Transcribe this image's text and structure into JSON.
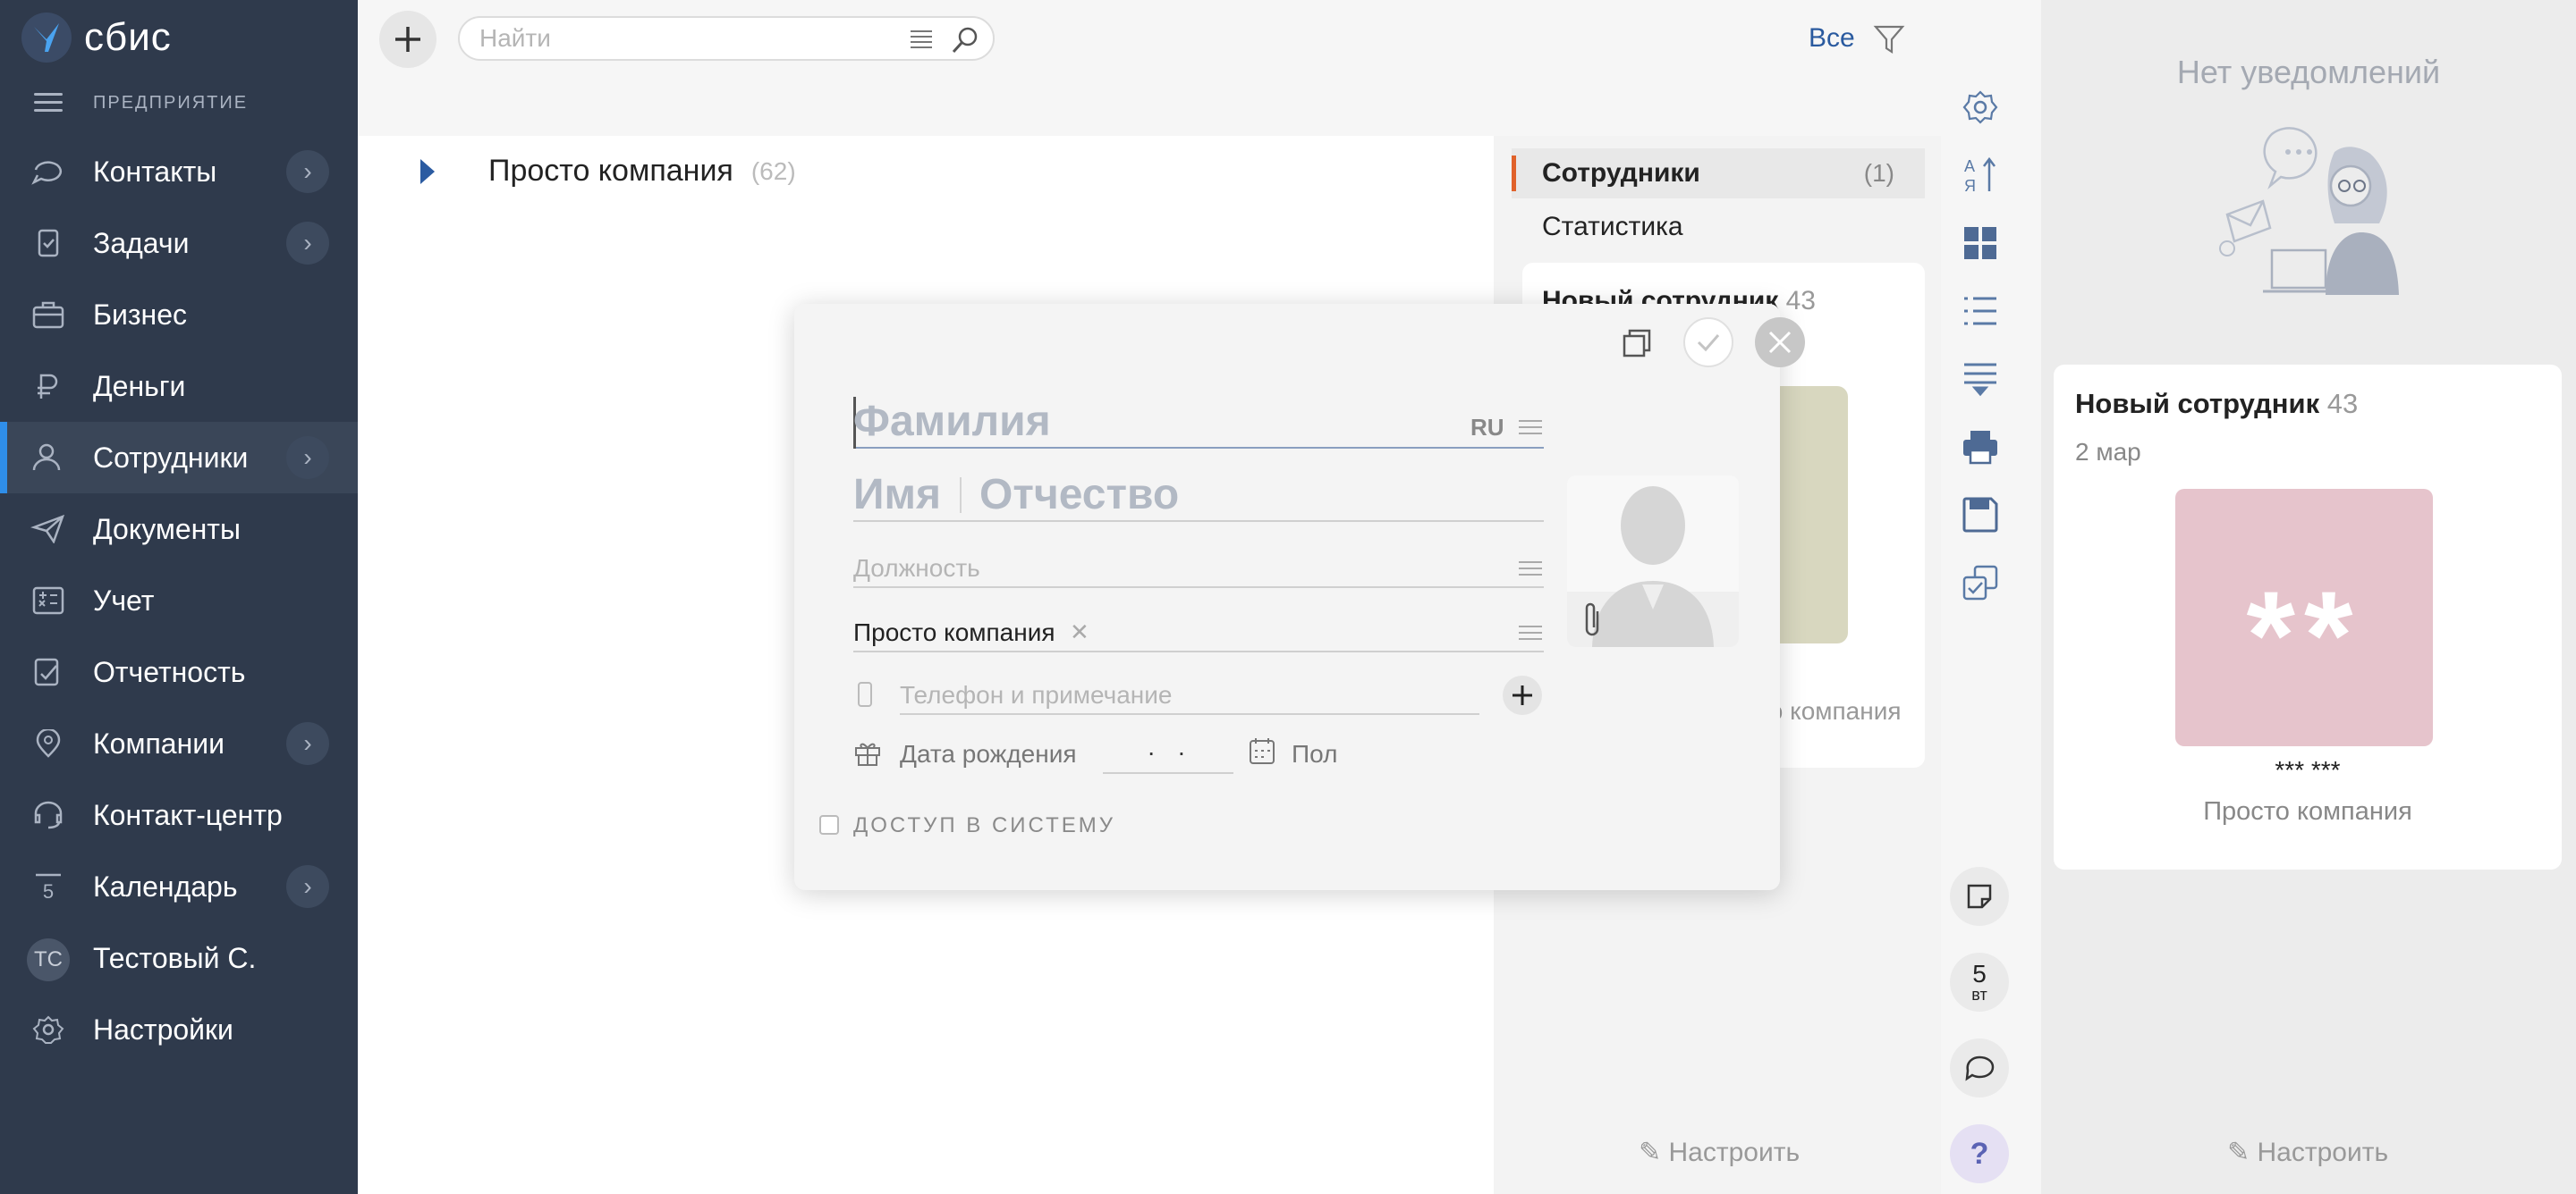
{
  "app": {
    "logo_text": "сбис",
    "section_label": "ПРЕДПРИЯТИЕ"
  },
  "sidebar": {
    "items": [
      {
        "label": "Контакты",
        "icon": "contacts-icon",
        "has_arrow": true
      },
      {
        "label": "Задачи",
        "icon": "tasks-icon",
        "has_arrow": true
      },
      {
        "label": "Бизнес",
        "icon": "business-icon",
        "has_arrow": false
      },
      {
        "label": "Деньги",
        "icon": "money-icon",
        "has_arrow": false
      },
      {
        "label": "Сотрудники",
        "icon": "employees-icon",
        "has_arrow": true,
        "active": true
      },
      {
        "label": "Документы",
        "icon": "documents-icon",
        "has_arrow": false
      },
      {
        "label": "Учет",
        "icon": "accounting-icon",
        "has_arrow": false
      },
      {
        "label": "Отчетность",
        "icon": "reports-icon",
        "has_arrow": false
      },
      {
        "label": "Компании",
        "icon": "companies-icon",
        "has_arrow": true
      },
      {
        "label": "Контакт-центр",
        "icon": "contact-center-icon",
        "has_arrow": false
      },
      {
        "label": "Календарь",
        "icon": "calendar-icon",
        "has_arrow": true,
        "icon_text": "5"
      },
      {
        "label": "Тестовый С.",
        "icon": "user-avatar",
        "has_arrow": false,
        "avatar_text": "ТС"
      },
      {
        "label": "Настройки",
        "icon": "settings-icon",
        "has_arrow": false
      }
    ]
  },
  "toolbar": {
    "search_placeholder": "Найти",
    "filter_label": "Все",
    "user_initials": "ТС"
  },
  "tree": {
    "name": "Просто компания",
    "count": "(62)"
  },
  "right_list": {
    "tabs": [
      {
        "label": "Сотрудники",
        "count": "(1)",
        "selected": true
      },
      {
        "label": "Статистика",
        "count": "",
        "selected": false
      }
    ],
    "card_title": "Новый сотрудник",
    "card_count": "43",
    "card_company": "Просто компания",
    "config_label": "Настроить"
  },
  "rail": {
    "icons": [
      "settings-icon",
      "sort-icon",
      "tiles-icon",
      "list-icon",
      "filter-list-icon",
      "print-icon",
      "save-icon",
      "mass-select-icon"
    ],
    "calendar_day": "5",
    "calendar_weekday": "вт",
    "help_label": "?"
  },
  "notifications": {
    "empty_text": "Нет уведомлений",
    "card_title": "Новый сотрудник",
    "card_count": "43",
    "card_date": "2 мар",
    "photo_text": "**",
    "stars": "*** ***",
    "company": "Просто компания",
    "config_label": "Настроить"
  },
  "dialog": {
    "surname_placeholder": "Фамилия",
    "lang": "RU",
    "name_placeholder": "Имя",
    "patronymic_placeholder": "Отчество",
    "position_placeholder": "Должность",
    "company_value": "Просто компания",
    "phone_placeholder": "Телефон и примечание",
    "birthday_label": "Дата рождения",
    "birthday_value": "..",
    "gender_label": "Пол",
    "access_label": "ДОСТУП В СИСТЕМУ"
  }
}
